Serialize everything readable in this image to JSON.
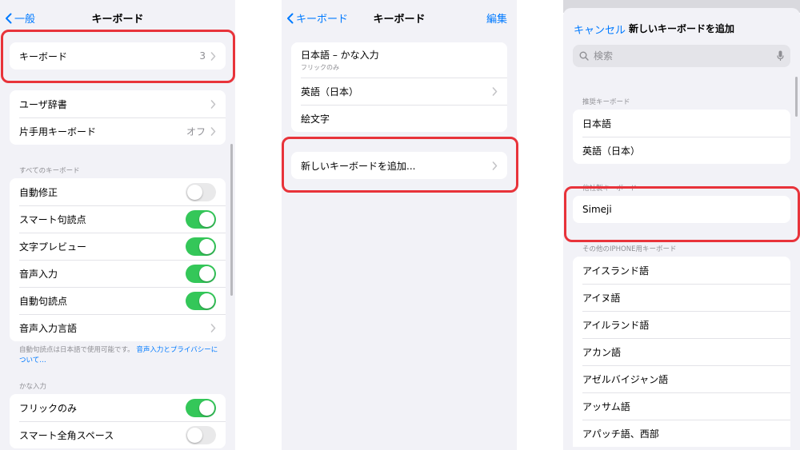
{
  "screen1": {
    "back_label": "一般",
    "title": "キーボード",
    "keyboards_row": {
      "label": "キーボード",
      "value": "3"
    },
    "group2": [
      {
        "label": "ユーザ辞書",
        "value": ""
      },
      {
        "label": "片手用キーボード",
        "value": "オフ"
      }
    ],
    "all_keyboards_header": "すべてのキーボード",
    "toggles": [
      {
        "label": "自動修正",
        "on": false
      },
      {
        "label": "スマート句読点",
        "on": true
      },
      {
        "label": "文字プレビュー",
        "on": true
      },
      {
        "label": "音声入力",
        "on": true
      },
      {
        "label": "自動句読点",
        "on": true
      }
    ],
    "dictation_languages_label": "音声入力言語",
    "footnote_text": "自動句読点は日本語で使用可能です。",
    "footnote_link": "音声入力とプライバシーについて…",
    "kana_header": "かな入力",
    "kana_toggles": [
      {
        "label": "フリックのみ",
        "on": true
      },
      {
        "label": "スマート全角スペース",
        "on": false
      }
    ]
  },
  "screen2": {
    "back_label": "キーボード",
    "title": "キーボード",
    "edit_label": "編集",
    "keyboards": [
      {
        "label": "日本語 – かな入力",
        "sub": "フリックのみ"
      },
      {
        "label": "英語（日本）",
        "sub": ""
      },
      {
        "label": "絵文字",
        "sub": ""
      }
    ],
    "add_label": "新しいキーボードを追加..."
  },
  "screen3": {
    "cancel_label": "キャンセル",
    "title": "新しいキーボードを追加",
    "search_placeholder": "検索",
    "suggested_header": "推奨キーボード",
    "suggested": [
      "日本語",
      "英語（日本）"
    ],
    "third_party_header": "他社製キーボード",
    "third_party": [
      "Simeji"
    ],
    "other_header": "その他のIPHONE用キーボード",
    "other": [
      "アイスランド語",
      "アイヌ語",
      "アイルランド語",
      "アカン語",
      "アゼルバイジャン語",
      "アッサム語",
      "アパッチ語、西部"
    ]
  },
  "colors": {
    "accent": "#007aff",
    "toggle_on": "#34c759",
    "highlight": "#e8333a"
  }
}
